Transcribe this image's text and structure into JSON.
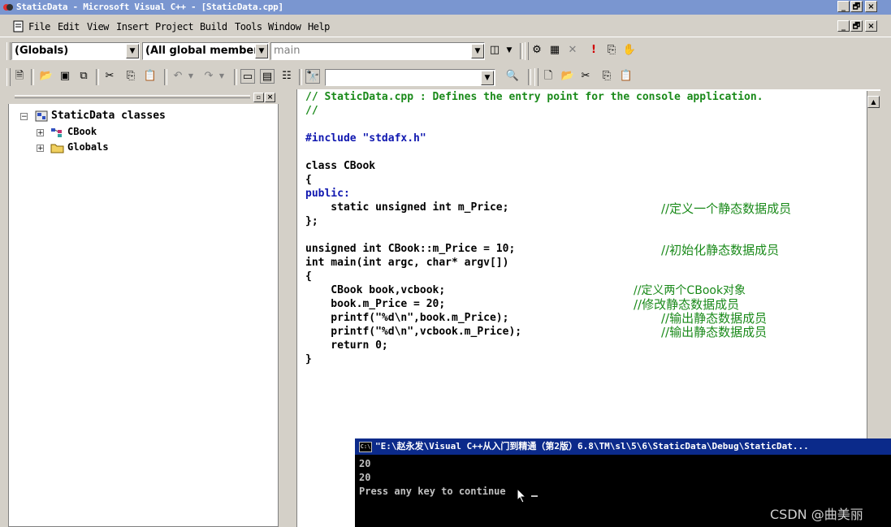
{
  "window": {
    "title": "StaticData - Microsoft Visual C++ - [StaticData.cpp]",
    "min_label": "_",
    "max_label": "🗗",
    "close_label": "×"
  },
  "menu": [
    "File",
    "Edit",
    "View",
    "Insert",
    "Project",
    "Build",
    "Tools",
    "Window",
    "Help"
  ],
  "wizardbar": {
    "scope": "(Globals)",
    "members": "(All global members",
    "function": "main"
  },
  "workspace": {
    "root": "StaticData classes",
    "items": [
      "CBook",
      "Globals"
    ]
  },
  "code": [
    "// StaticData.cpp : Defines the entry point for the console application.",
    "//",
    "",
    "#include \"stdafx.h\"",
    "",
    "class CBook",
    "{",
    "public:",
    "    static unsigned int m_Price;",
    "};",
    "",
    "unsigned int CBook::m_Price = 10;",
    "int main(int argc, char* argv[])",
    "{",
    "    CBook book,vcbook;",
    "    book.m_Price = 20;",
    "    printf(\"%d\\n\",book.m_Price);",
    "    printf(\"%d\\n\",vcbook.m_Price);",
    "    return 0;",
    "}"
  ],
  "comments": {
    "c1": "//定义一个静态数据成员",
    "c2": "//初始化静态数据成员",
    "c3": "//定义两个CBook对象",
    "c4": "//修改静态数据成员",
    "c5": "//输出静态数据成员",
    "c6": "//输出静态数据成员"
  },
  "console": {
    "title": "\"E:\\赵永发\\Visual C++从入门到精通（第2版）6.8\\TM\\sl\\5\\6\\StaticData\\Debug\\StaticDat...",
    "lines": [
      "20",
      "20",
      "Press any key to continue"
    ]
  },
  "watermark": "CSDN @曲美丽",
  "colors": {
    "keyword": "#1018b0",
    "comment": "#1a8a1a",
    "titlebar": "#7a96d0",
    "console_title": "#0b2a8a"
  }
}
